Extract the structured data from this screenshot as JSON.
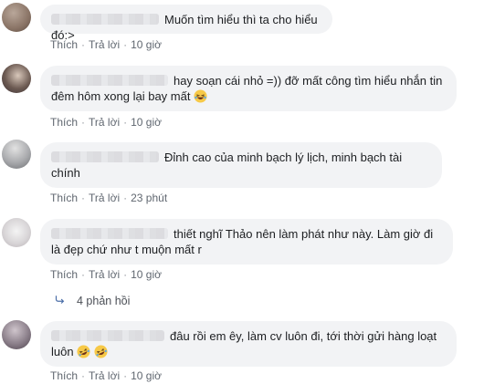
{
  "comments": [
    {
      "text": "Muốn tìm hiểu thì ta cho hiểu đó:>",
      "action1": "Thích",
      "action2": "Trả lời",
      "time": "10 giờ",
      "emoji": []
    },
    {
      "text": "hay soạn cái nhỏ =)) đỡ mất công tìm hiểu nhắn tin đêm hôm xong lại bay mất",
      "action1": "Thích",
      "action2": "Trả lời",
      "time": "10 giờ",
      "emoji": [
        "laughing-emoji"
      ]
    },
    {
      "text": "Đỉnh cao của minh bạch lý lịch, minh bạch tài chính",
      "action1": "Thích",
      "action2": "Trả lời",
      "time": "23 phút",
      "emoji": []
    },
    {
      "text": "thiết nghĩ Thảo nên làm phát như này. Làm giờ đi là đẹp chứ như t muộn mất r",
      "action1": "Thích",
      "action2": "Trả lời",
      "time": "10 giờ",
      "emoji": []
    },
    {
      "text": "đâu rồi em êy, làm cv luôn đi, tới thời gửi hàng loạt luôn",
      "action1": "Thích",
      "action2": "Trả lời",
      "time": "10 giờ",
      "emoji": [
        "rofl-emoji",
        "rofl-emoji"
      ]
    }
  ],
  "replies": {
    "label": "4 phản hồi",
    "icon": "reply-arrow-icon"
  },
  "colors": {
    "bubble": "#f2f3f5",
    "meta": "#606770",
    "text": "#1c1e21"
  }
}
